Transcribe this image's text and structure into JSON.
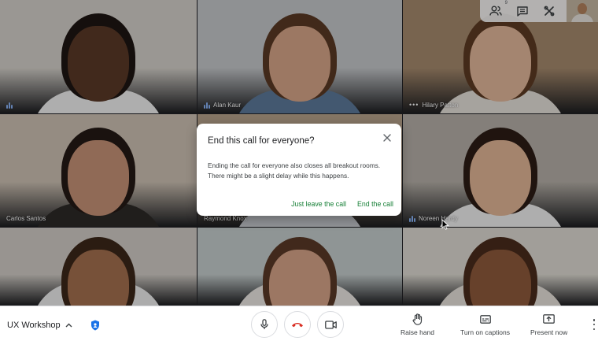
{
  "participants": [
    {
      "name": "",
      "speaking": true,
      "more": false,
      "bg": "#d6d2cc",
      "skin": "#5a3a28",
      "hair": "#1e1612",
      "shirt": "#f2f2f2"
    },
    {
      "name": "Alan Kaur",
      "speaking": true,
      "more": false,
      "bg": "#c6c9cc",
      "skin": "#d9a789",
      "hair": "#5b3a24",
      "shirt": "#5e7b9c"
    },
    {
      "name": "Hilary Patton",
      "speaking": false,
      "more": true,
      "bg": "#a78b6e",
      "skin": "#e4b99c",
      "hair": "#5d3b23",
      "shirt": "#e7e2dc"
    },
    {
      "name": "Carlos Santos",
      "speaking": false,
      "more": false,
      "bg": "#cfc3b5",
      "skin": "#c89478",
      "hair": "#241a16",
      "shirt": "#2d2a28"
    },
    {
      "name": "Raymond Knox",
      "speaking": false,
      "more": false,
      "bg": "#b9a48c",
      "skin": "#d6a283",
      "hair": "#231814",
      "shirt": "#c8cbd0"
    },
    {
      "name": "Noreen Hardy",
      "speaking": true,
      "more": false,
      "bg": "#b7b1a9",
      "skin": "#e4b898",
      "hair": "#2d1d16",
      "shirt": "#f1f1f1"
    },
    {
      "name": "",
      "speaking": false,
      "more": false,
      "bg": "#d3cec8",
      "skin": "#a6714f",
      "hair": "#3c271a",
      "shirt": "#efefef"
    },
    {
      "name": "",
      "speaking": false,
      "more": false,
      "bg": "#c7cfcf",
      "skin": "#d8a68a",
      "hair": "#5a3a27",
      "shirt": "#ede9e5"
    },
    {
      "name": "",
      "speaking": false,
      "more": false,
      "bg": "#e0dcd4",
      "skin": "#8f5b3c",
      "hair": "#4a2c1c",
      "shirt": "#e9e4dd"
    }
  ],
  "topbar": {
    "people_count": "9",
    "icons": [
      "people-icon",
      "chat-icon",
      "activities-icon"
    ]
  },
  "dialog": {
    "title": "End this call for everyone?",
    "body": "Ending the call for everyone also closes all breakout rooms. There might be a slight delay while this happens.",
    "secondary_action": "Just leave the call",
    "primary_action": "End the call",
    "accent_color": "#188038"
  },
  "bottombar": {
    "meeting_name": "UX Workshop",
    "raise_hand": "Raise hand",
    "captions": "Turn on captions",
    "present": "Present now",
    "hangup_color": "#d93025"
  }
}
